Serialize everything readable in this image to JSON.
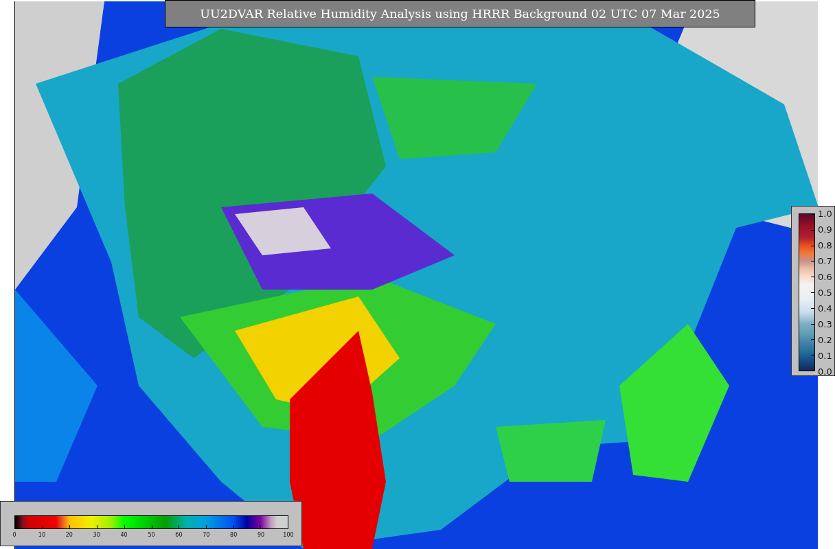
{
  "title": "UU2DVAR Relative Humidity Analysis using HRRR Background 02 UTC 07 Mar 2025",
  "humidity_colorbar": {
    "ticks": [
      "0",
      "10",
      "20",
      "30",
      "40",
      "50",
      "60",
      "70",
      "80",
      "90",
      "100"
    ]
  },
  "observation_colorbar": {
    "ticks": [
      "1.0",
      "0.9",
      "0.8",
      "0.7",
      "0.6",
      "0.5",
      "0.4",
      "0.3",
      "0.2",
      "0.1",
      "0.0"
    ]
  }
}
